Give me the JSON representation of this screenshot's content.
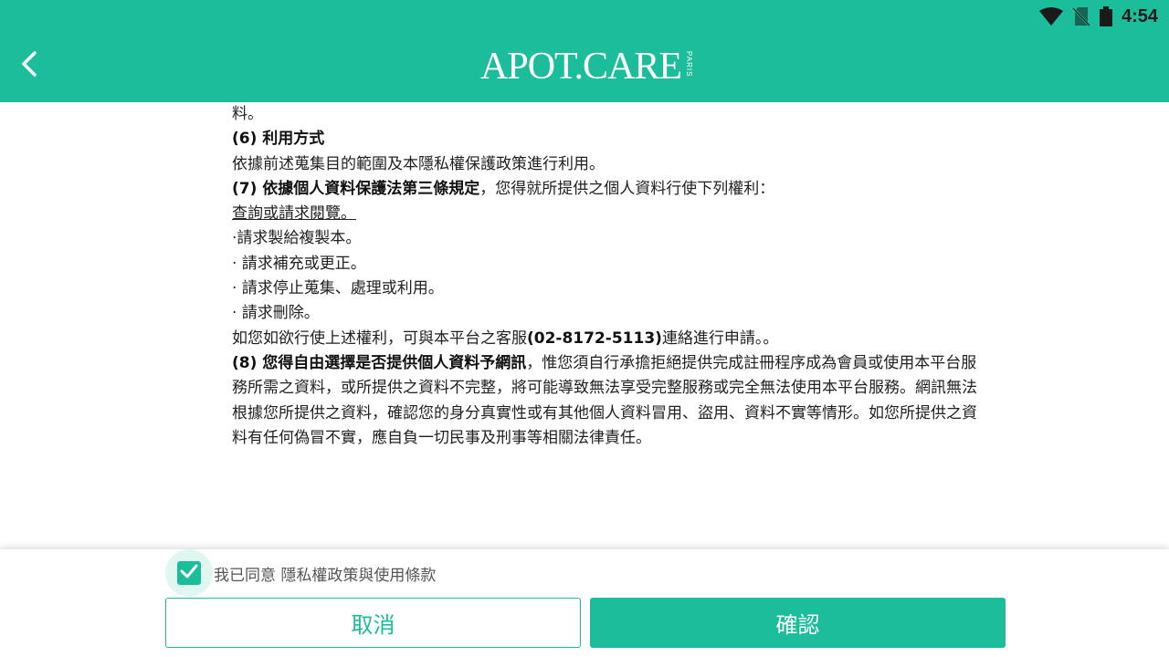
{
  "status_bar": {
    "time": "4:54"
  },
  "header": {
    "brand": "APOT.CARE",
    "brand_sub": "PARIS"
  },
  "content": {
    "line1": "料。",
    "s6_title": "(6) 利用方式",
    "s6_body": "依據前述蒐集目的範圍及本隱私權保護政策進行利用。",
    "s7_title": "(7) 依據個人資料保護法第三條規定",
    "s7_rest": "，您得就所提供之個人資料行使下列權利：",
    "r1": "查詢或請求閱覽。",
    "r2": "·請求製給複製本。",
    "r3": "· 請求補充或更正。",
    "r4": "· 請求停止蒐集、處理或利用。",
    "r5": "· 請求刪除。",
    "contact_pre": "如您如欲行使上述權利，可與本平台之客服",
    "contact_phone": "(02-8172-5113)",
    "contact_post": "連絡進行申請。。",
    "s8_title": "(8) 您得自由選擇是否提供個人資料予網訊",
    "s8_body": "，惟您須自行承擔拒絕提供完成註冊程序成為會員或使用本平台服務所需之資料，或所提供之資料不完整，將可能導致無法享受完整服務或完全無法使用本平台服務。網訊無法根據您所提供之資料，確認您的身分真實性或有其他個人資料冒用、盜用、資料不實等情形。如您所提供之資料有任何偽冒不實，應自負一切民事及刑事等相關法律責任。"
  },
  "footer": {
    "agree_label": "我已同意 隱私權政策與使用條款",
    "agree_checked": true,
    "cancel_label": "取消",
    "confirm_label": "確認"
  },
  "colors": {
    "primary": "#1bbd9b",
    "text": "#212121"
  },
  "icons": [
    "wifi-icon",
    "no-sim-icon",
    "battery-icon",
    "back-arrow-icon",
    "checkmark-icon"
  ]
}
